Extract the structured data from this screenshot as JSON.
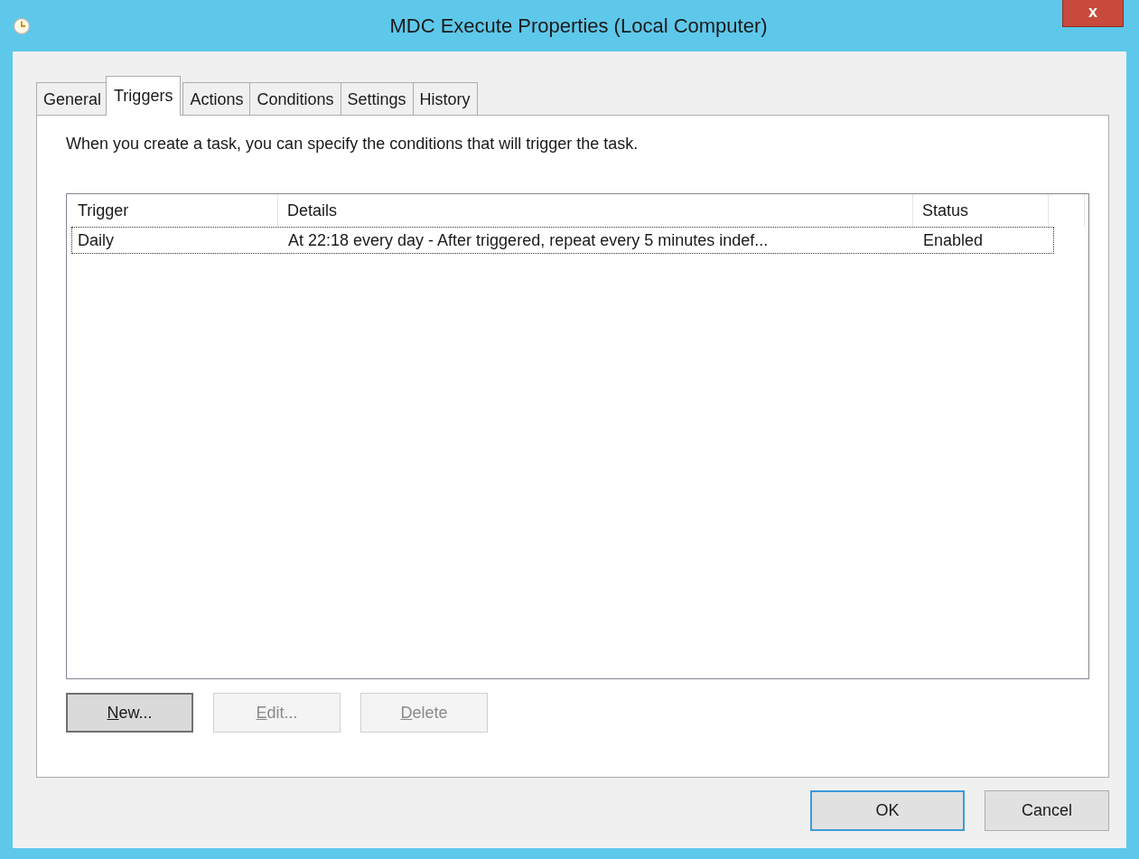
{
  "window": {
    "title": "MDC Execute Properties (Local Computer)",
    "close": "x"
  },
  "tabs": [
    {
      "label": "General",
      "selected": false
    },
    {
      "label": "Triggers",
      "selected": true
    },
    {
      "label": "Actions",
      "selected": false
    },
    {
      "label": "Conditions",
      "selected": false
    },
    {
      "label": "Settings",
      "selected": false
    },
    {
      "label": "History",
      "selected": false
    }
  ],
  "description": "When you create a task, you can specify the conditions that will trigger the task.",
  "table": {
    "columns": [
      "Trigger",
      "Details",
      "Status"
    ],
    "rows": [
      {
        "cells": [
          "Daily",
          "At 22:18 every day - After triggered, repeat every 5 minutes indef...",
          "Enabled"
        ],
        "focused": true
      }
    ]
  },
  "list_buttons": [
    {
      "label": "New...",
      "disabled": false,
      "focused": true
    },
    {
      "label": "Edit...",
      "disabled": true,
      "focused": false
    },
    {
      "label": "Delete",
      "disabled": true,
      "focused": false
    }
  ],
  "dialog_buttons": [
    {
      "label": "OK",
      "default": true
    },
    {
      "label": "Cancel",
      "default": false
    }
  ]
}
